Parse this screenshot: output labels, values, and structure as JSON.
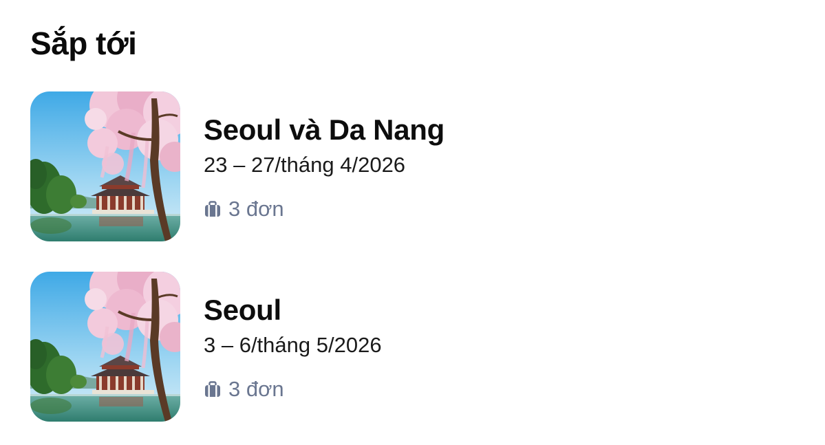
{
  "section": {
    "title": "Sắp tới"
  },
  "trips": [
    {
      "title": "Seoul và Da Nang",
      "dates": "23 – 27/tháng 4/2026",
      "orders": "3 đơn",
      "image": "gyeongbokgung-cherry-blossom-photo"
    },
    {
      "title": "Seoul",
      "dates": "3 – 6/tháng 5/2026",
      "orders": "3 đơn",
      "image": "gyeongbokgung-cherry-blossom-photo"
    }
  ],
  "icons": {
    "orders": "luggage-icon"
  },
  "colors": {
    "title": "#0d0d0d",
    "secondary": "#6a7690",
    "background": "#ffffff"
  }
}
